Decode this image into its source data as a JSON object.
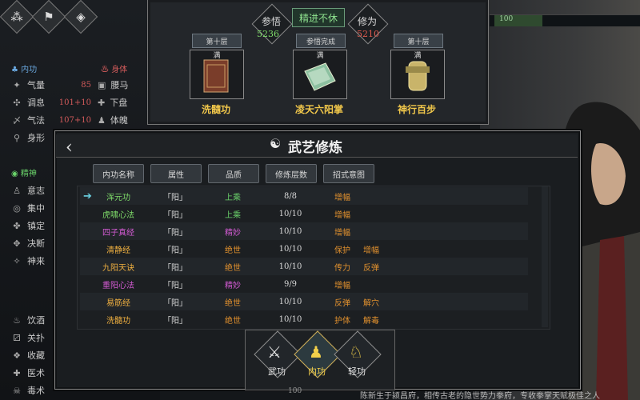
{
  "top_icons": [
    "cluster-icon",
    "flag-icon",
    "target-icon"
  ],
  "top_bar_right": {
    "value": "100"
  },
  "left_panel": {
    "internal_header": "内功",
    "body_header": "身体",
    "internal_stats": [
      {
        "label": "气量",
        "value": "85"
      },
      {
        "label": "调息",
        "value": "101+10"
      },
      {
        "label": "气法",
        "value": "107+10"
      },
      {
        "label": "身形",
        "value": ""
      }
    ],
    "body_stats": [
      {
        "label": "腰马"
      },
      {
        "label": "下盘"
      },
      {
        "label": "体魄"
      }
    ],
    "spirit_header": "精神",
    "spirit_stats": [
      {
        "label": "意志"
      },
      {
        "label": "集中"
      },
      {
        "label": "镇定"
      },
      {
        "label": "决断"
      },
      {
        "label": "神来"
      }
    ],
    "misc_stats": [
      {
        "label": "饮酒"
      },
      {
        "label": "关扑"
      },
      {
        "label": "收藏"
      },
      {
        "label": "医术"
      },
      {
        "label": "毒术"
      }
    ]
  },
  "top_panel": {
    "center_title": "精进不休",
    "insight": {
      "label": "参悟",
      "value": "5236",
      "color": "#7fdc6a"
    },
    "cultivation": {
      "label": "修为",
      "value": "5210",
      "color": "#e05a4e"
    },
    "books": [
      {
        "tier": "第十层",
        "status": "满",
        "name": "洗髓功",
        "icon": "book-icon"
      },
      {
        "tier": "参悟完成",
        "status": "满",
        "name": "凌天六阳掌",
        "icon": "scroll-icon"
      },
      {
        "tier": "第十层",
        "status": "满",
        "name": "神行百步",
        "icon": "boot-icon"
      }
    ]
  },
  "main": {
    "title": "武艺修炼",
    "columns": [
      "内功名称",
      "属性",
      "品质",
      "修炼层数",
      "招式意图"
    ],
    "rows": [
      {
        "name": "浑元功",
        "attr": "「阳」",
        "grade": "上乘",
        "level": "8/8",
        "effects": [
          "增幅"
        ],
        "name_color": "#7fdc6a",
        "selected": true
      },
      {
        "name": "虎啸心法",
        "attr": "「阳」",
        "grade": "上乘",
        "level": "10/10",
        "effects": [
          "增幅"
        ],
        "name_color": "#7fdc6a"
      },
      {
        "name": "四子真经",
        "attr": "「阳」",
        "grade": "精妙",
        "level": "10/10",
        "effects": [
          "增幅"
        ],
        "name_color": "#d35bd3"
      },
      {
        "name": "清静经",
        "attr": "「阳」",
        "grade": "绝世",
        "level": "10/10",
        "effects": [
          "保护",
          "增幅"
        ],
        "name_color": "#f0b040"
      },
      {
        "name": "九阳天诀",
        "attr": "「阳」",
        "grade": "绝世",
        "level": "10/10",
        "effects": [
          "传力",
          "反弹"
        ],
        "name_color": "#f0b040"
      },
      {
        "name": "重阳心法",
        "attr": "「阳」",
        "grade": "精妙",
        "level": "9/9",
        "effects": [
          "增幅"
        ],
        "name_color": "#d35bd3"
      },
      {
        "name": "易筋经",
        "attr": "「阳」",
        "grade": "绝世",
        "level": "10/10",
        "effects": [
          "反弹",
          "解穴"
        ],
        "name_color": "#f0b040"
      },
      {
        "name": "洗髓功",
        "attr": "「阳」",
        "grade": "绝世",
        "level": "10/10",
        "effects": [
          "护体",
          "解毒"
        ],
        "name_color": "#f0b040"
      }
    ]
  },
  "bottom_nav": [
    {
      "label": "武功",
      "icon": "sword-icon",
      "active": false
    },
    {
      "label": "内功",
      "icon": "meditation-icon",
      "active": true
    },
    {
      "label": "轻功",
      "icon": "boot-icon",
      "active": false
    }
  ],
  "footer_text": "陈新生于颍昌府，相传古老的隐世势力拳府，专收拳掌天赋极佳之人",
  "footer_left_value": "100"
}
